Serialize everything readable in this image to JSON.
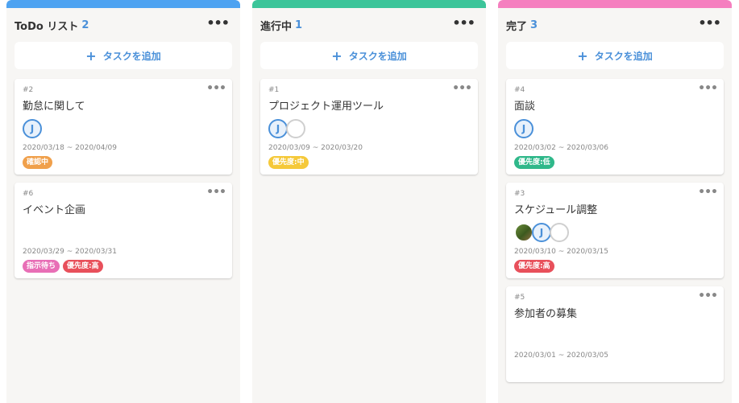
{
  "add_task_label": "タスクを追加",
  "columns": [
    {
      "title": "ToDo リスト",
      "count": "2",
      "color": "#4ea3f1",
      "cards": [
        {
          "id": "#2",
          "title": "勤怠に関して",
          "avatars": [
            "jj"
          ],
          "dates": "2020/03/18 ~ 2020/04/09",
          "labels": [
            {
              "text": "確認中",
              "color": "#f0a04b"
            }
          ]
        },
        {
          "id": "#6",
          "title": "イベント企画",
          "avatars": [],
          "dates": "2020/03/29 ~ 2020/03/31",
          "labels": [
            {
              "text": "指示待ち",
              "color": "#e86fb6"
            },
            {
              "text": "優先度:高",
              "color": "#e8505b"
            }
          ]
        }
      ]
    },
    {
      "title": "進行中",
      "count": "1",
      "color": "#3cc59a",
      "cards": [
        {
          "id": "#1",
          "title": "プロジェクト運用ツール",
          "avatars": [
            "jj",
            "blank"
          ],
          "dates": "2020/03/09 ~ 2020/03/20",
          "labels": [
            {
              "text": "優先度:中",
              "color": "#f5c93a"
            }
          ]
        }
      ]
    },
    {
      "title": "完了",
      "count": "3",
      "color": "#f57fbf",
      "cards": [
        {
          "id": "#4",
          "title": "面談",
          "avatars": [
            "jj"
          ],
          "dates": "2020/03/02 ~ 2020/03/06",
          "labels": [
            {
              "text": "優先度:低",
              "color": "#2fb88a"
            }
          ]
        },
        {
          "id": "#3",
          "title": "スケジュール調整",
          "avatars": [
            "photo",
            "jj",
            "blank"
          ],
          "dates": "2020/03/10 ~ 2020/03/15",
          "labels": [
            {
              "text": "優先度:高",
              "color": "#e8505b"
            }
          ]
        },
        {
          "id": "#5",
          "title": "参加者の募集",
          "avatars": [],
          "dates": "2020/03/01 ~ 2020/03/05",
          "labels": []
        }
      ]
    }
  ]
}
